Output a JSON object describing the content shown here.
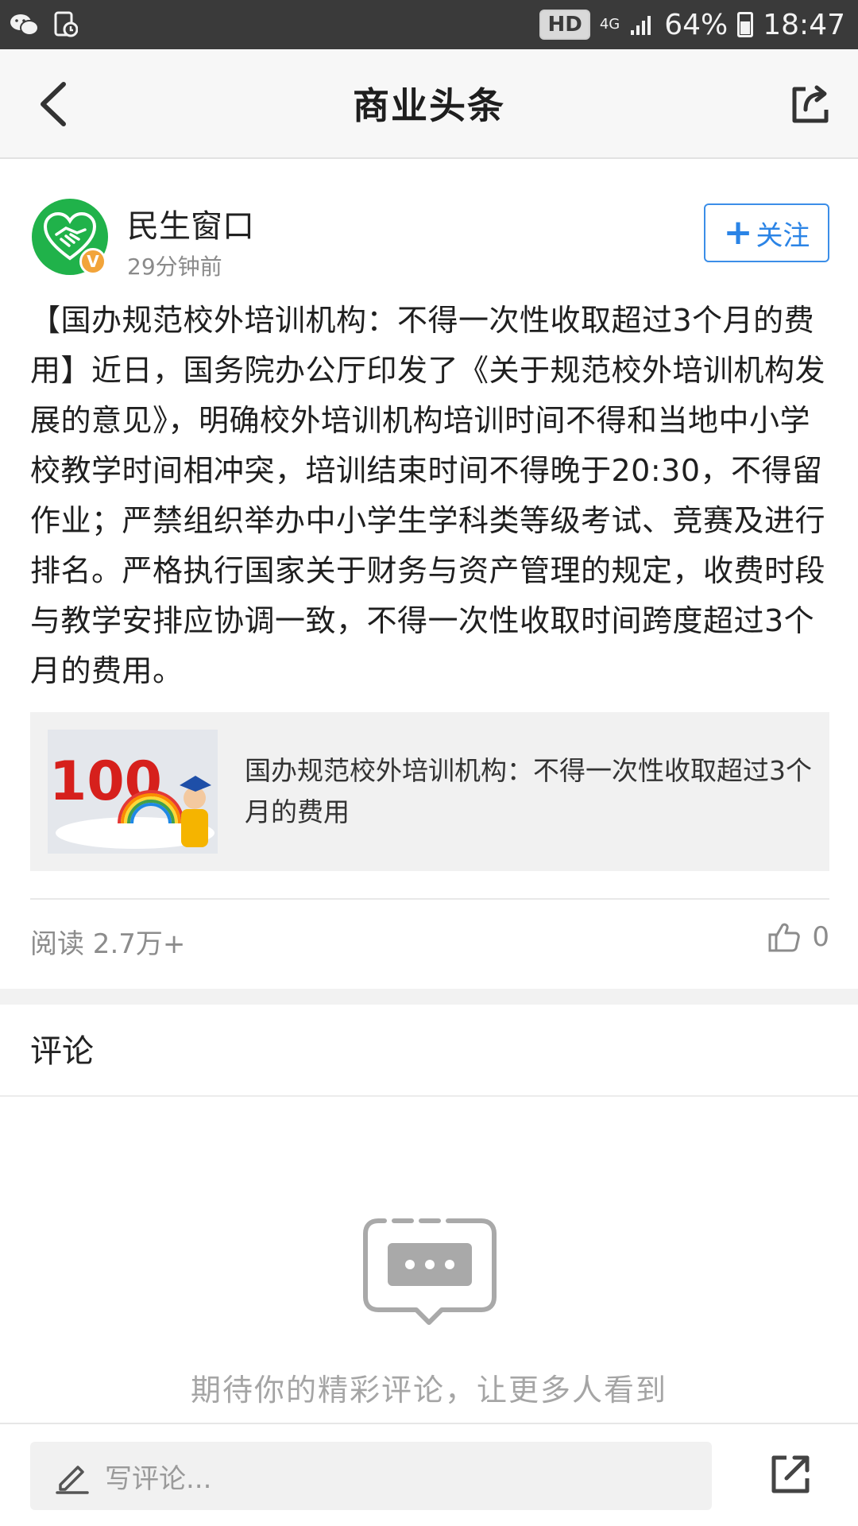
{
  "status_bar": {
    "hd_label": "HD",
    "network_label": "4G",
    "battery_percent": "64%",
    "time": "18:47"
  },
  "header": {
    "title": "商业头条"
  },
  "author": {
    "name": "民生窗口",
    "time_ago": "29分钟前",
    "verified_badge": "V",
    "follow_plus": "+",
    "follow_label": "关注"
  },
  "article": {
    "body": "【国办规范校外培训机构：不得一次性收取超过3个月的费用】近日，国务院办公厅印发了《关于规范校外培训机构发展的意见》，明确校外培训机构培训时间不得和当地中小学校教学时间相冲突，培训结束时间不得晚于20:30，不得留作业；严禁组织举办中小学生学科类等级考试、竞赛及进行排名。严格执行国家关于财务与资产管理的规定，收费时段与教学安排应协调一致，不得一次性收取时间跨度超过3个月的费用。"
  },
  "link_card": {
    "title": "国办规范校外培训机构：不得一次性收取超过3个月的费用",
    "thumbnail_text": "100"
  },
  "stats": {
    "reads": "阅读 2.7万+",
    "likes": "0"
  },
  "comments": {
    "heading": "评论",
    "empty_text": "期待你的精彩评论，让更多人看到"
  },
  "bottom_bar": {
    "input_placeholder": "写评论..."
  },
  "colors": {
    "accent": "#2b84e6",
    "avatar_green": "#20b24a",
    "badge_orange": "#f2a43a",
    "status_bar": "#3a3a3a"
  }
}
